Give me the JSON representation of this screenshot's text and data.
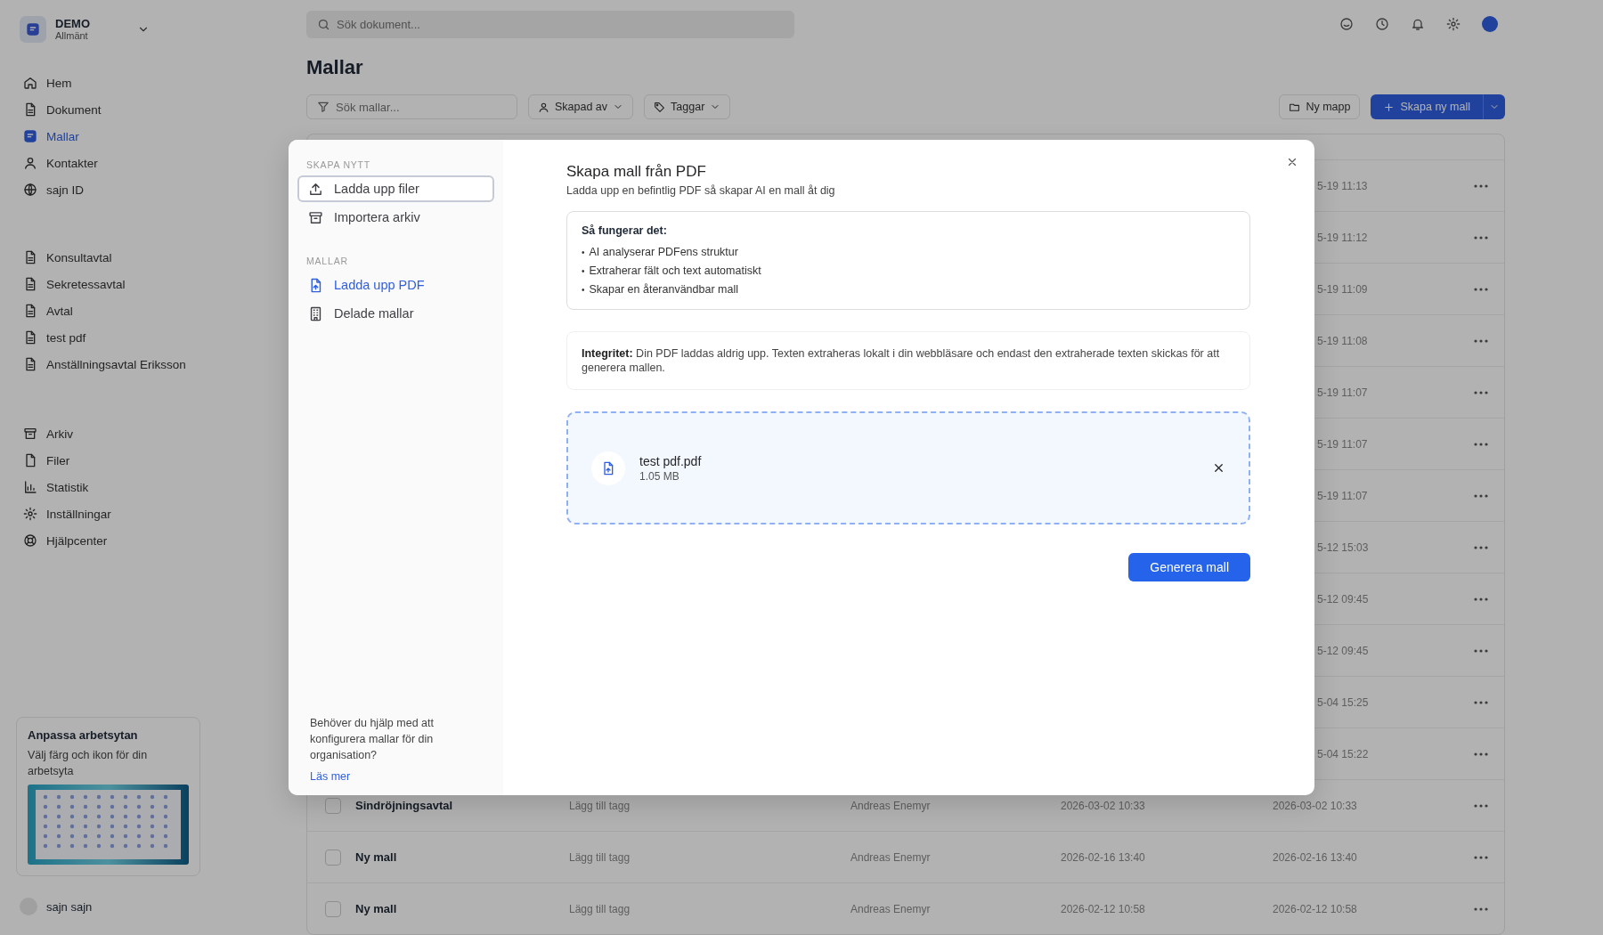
{
  "sidebar": {
    "workspace": {
      "name": "DEMO",
      "subtitle": "Allmänt"
    },
    "nav": [
      {
        "label": "Hem",
        "selected": false
      },
      {
        "label": "Dokument",
        "selected": false
      },
      {
        "label": "Mallar",
        "selected": true
      },
      {
        "label": "Kontakter",
        "selected": false
      },
      {
        "label": "sajn ID",
        "selected": false
      }
    ],
    "groups": [
      {
        "items": [
          {
            "label": "Konsultavtal"
          },
          {
            "label": "Sekretessavtal"
          },
          {
            "label": "Avtal"
          },
          {
            "label": "test pdf"
          },
          {
            "label": "Anställningsavtal Eriksson"
          }
        ]
      },
      {
        "items": [
          {
            "label": "Arkiv"
          },
          {
            "label": "Filer"
          },
          {
            "label": "Statistik"
          },
          {
            "label": "Inställningar"
          },
          {
            "label": "Hjälpcenter"
          }
        ]
      }
    ],
    "promo": {
      "title": "Anpassa arbetsytan",
      "text": "Välj färg och ikon för din arbetsyta"
    },
    "user": {
      "name": "sajn sajn"
    }
  },
  "topbar": {
    "search": {
      "placeholder": "Sök dokument..."
    }
  },
  "page": {
    "title": "Mallar",
    "filter": {
      "placeholder": "Sök mallar..."
    },
    "dropdowns": [
      {
        "label": "Skapad av"
      },
      {
        "label": "Taggar"
      }
    ],
    "new_folder": "Ny mapp",
    "create": "Skapa ny mall"
  },
  "table": {
    "partial_rows": [
      {
        "updated": "5-19 11:13"
      },
      {
        "updated": "5-19 11:12"
      },
      {
        "updated": "5-19 11:09"
      },
      {
        "updated": "5-19 11:08"
      },
      {
        "updated": "5-19 11:07"
      },
      {
        "updated": "5-19 11:07"
      },
      {
        "updated": "5-19 11:07"
      },
      {
        "updated": "5-12 15:03"
      },
      {
        "updated": "5-12 09:45"
      },
      {
        "updated": "5-12 09:45"
      },
      {
        "updated": "5-04 15:25"
      },
      {
        "updated": "5-04 15:22"
      }
    ],
    "rows": [
      {
        "name": "Sindröjningsavtal",
        "tags": "Lägg till tagg",
        "creator": "Andreas Enemyr",
        "created": "2026-03-02 10:33",
        "updated": "2026-03-02 10:33",
        "checked": false
      },
      {
        "name": "Ny mall",
        "tags": "Lägg till tagg",
        "creator": "Andreas Enemyr",
        "created": "2026-02-16 13:40",
        "updated": "2026-02-16 13:40",
        "checked": false
      },
      {
        "name": "Ny mall",
        "tags": "Lägg till tagg",
        "creator": "Andreas Enemyr",
        "created": "2026-02-12 10:58",
        "updated": "2026-02-12 10:58",
        "checked": false
      }
    ]
  },
  "modal": {
    "sections": [
      {
        "heading": "SKAPA NYTT",
        "items": [
          {
            "label": "Ladda upp filer",
            "selected": false,
            "focused": true
          },
          {
            "label": "Importera arkiv",
            "selected": false,
            "focused": false
          }
        ]
      },
      {
        "heading": "MALLAR",
        "items": [
          {
            "label": "Ladda upp PDF",
            "selected": true,
            "focused": false
          },
          {
            "label": "Delade mallar",
            "selected": false,
            "focused": false
          }
        ]
      }
    ],
    "help": {
      "text": "Behöver du hjälp med att konfigurera mallar för din organisation?",
      "link": "Läs mer"
    },
    "title": "Skapa mall från PDF",
    "subtitle": "Ladda upp en befintlig PDF så skapar AI en mall åt dig",
    "info": {
      "heading": "Så fungerar det:",
      "bullet": "•",
      "items": [
        "AI analyserar PDFens struktur",
        "Extraherar fält och text automatiskt",
        "Skapar en återanvändbar mall"
      ]
    },
    "privacy": "**Integritet:** Din PDF laddas aldrig upp. Texten extraheras lokalt i din webbläsare och endast den extraherade texten skickas för att generera mallen.",
    "file": {
      "name": "test pdf.pdf",
      "size": "1.05 MB"
    },
    "submit": "Generera mall"
  }
}
